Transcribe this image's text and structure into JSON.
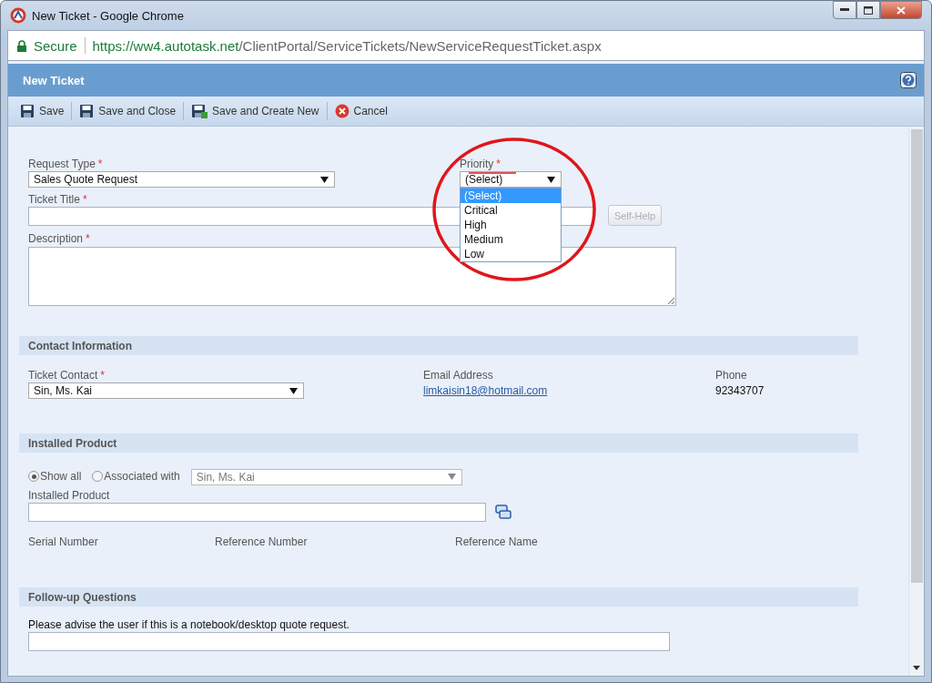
{
  "window": {
    "title": "New Ticket - Google Chrome"
  },
  "address_bar": {
    "secure_label": "Secure",
    "url_host": "https://ww4.autotask.net",
    "url_path": "/ClientPortal/ServiceTickets/NewServiceRequestTicket.aspx"
  },
  "header": {
    "title": "New Ticket"
  },
  "toolbar": [
    {
      "label": "Save",
      "kind": "save"
    },
    {
      "label": "Save and Close",
      "kind": "save"
    },
    {
      "label": "Save and Create New",
      "kind": "save-new"
    },
    {
      "label": "Cancel",
      "kind": "cancel"
    }
  ],
  "form": {
    "request_type": {
      "label": "Request Type",
      "required_mark": "*",
      "value": "Sales Quote Request"
    },
    "priority": {
      "label": "Priority",
      "required_mark": "*",
      "value": "(Select)",
      "expanded": true,
      "options": [
        {
          "label": "(Select)",
          "selected": true
        },
        {
          "label": "Critical",
          "selected": false
        },
        {
          "label": "High",
          "selected": false
        },
        {
          "label": "Medium",
          "selected": false
        },
        {
          "label": "Low",
          "selected": false
        }
      ]
    },
    "ticket_title": {
      "label": "Ticket Title",
      "required_mark": "*"
    },
    "self_help": {
      "label": "Self-Help",
      "disabled": true
    },
    "description": {
      "label": "Description",
      "required_mark": "*"
    }
  },
  "contact_section": {
    "title": "Contact Information",
    "ticket_contact": {
      "label": "Ticket Contact",
      "required_mark": "*",
      "value": "Sin, Ms. Kai"
    },
    "email": {
      "label": "Email Address",
      "value": "limkaisin18@hotmail.com"
    },
    "phone": {
      "label": "Phone",
      "value": "92343707"
    }
  },
  "installed_product_section": {
    "title": "Installed Product",
    "filters": [
      {
        "label": "Show all",
        "selected": true
      },
      {
        "label": "Associated with",
        "selected": false
      }
    ],
    "associated_contact": {
      "value": "Sin, Ms. Kai",
      "disabled": true
    },
    "installed_product": {
      "label": "Installed Product"
    },
    "columns": [
      "Serial Number",
      "Reference Number",
      "Reference Name"
    ]
  },
  "follow_up_section": {
    "title": "Follow-up Questions",
    "questions": [
      {
        "label": "Please advise the user if this is a notebook/desktop quote request."
      }
    ]
  }
}
